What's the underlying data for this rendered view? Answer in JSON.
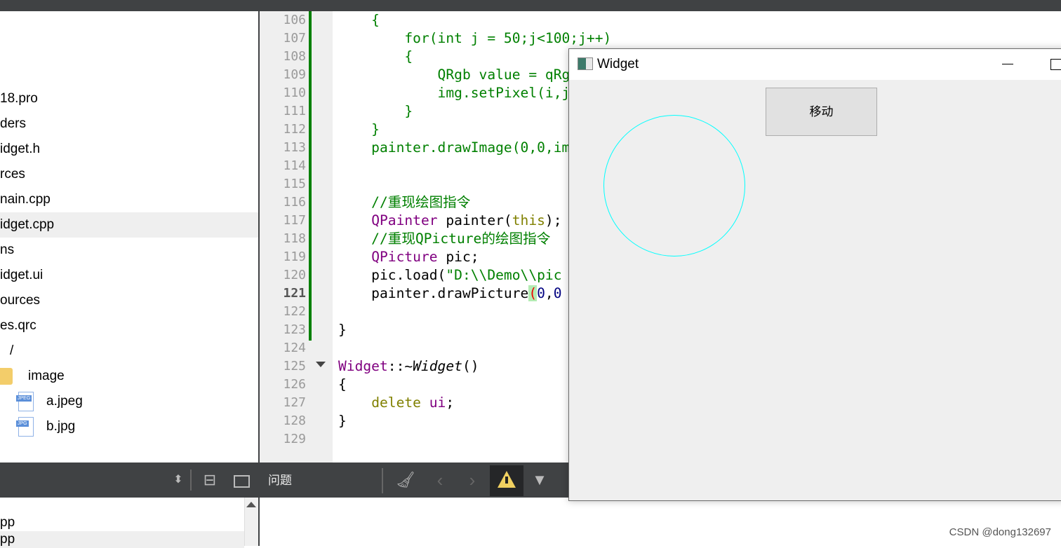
{
  "project_tree": {
    "items": [
      {
        "label": "18.pro",
        "indent": 0
      },
      {
        "label": "ders",
        "indent": 0
      },
      {
        "label": "idget.h",
        "indent": 0
      },
      {
        "label": "rces",
        "indent": 0
      },
      {
        "label": "nain.cpp",
        "indent": 0
      },
      {
        "label": "idget.cpp",
        "indent": 0,
        "selected": true
      },
      {
        "label": "ns",
        "indent": 0
      },
      {
        "label": "idget.ui",
        "indent": 0
      },
      {
        "label": "ources",
        "indent": 0
      },
      {
        "label": "es.qrc",
        "indent": 0
      },
      {
        "label": "/",
        "indent": 14
      },
      {
        "label": "image",
        "indent": 40,
        "icon": "folder-icon"
      },
      {
        "label": "a.jpeg",
        "indent": 66,
        "icon": "jpeg-file-icon",
        "badge": "JPEG"
      },
      {
        "label": "b.jpg",
        "indent": 66,
        "icon": "jpg-file-icon",
        "badge": "JPG"
      }
    ]
  },
  "open_documents": [
    "pp",
    "pp"
  ],
  "editor": {
    "current_line": 121,
    "lines": [
      {
        "n": 106,
        "tokens": [
          [
            "    {",
            "t-cm"
          ]
        ]
      },
      {
        "n": 107,
        "tokens": [
          [
            "        for(int j = 50;j<100;j++)",
            "t-cm"
          ]
        ]
      },
      {
        "n": 108,
        "tokens": [
          [
            "        {",
            "t-cm"
          ]
        ]
      },
      {
        "n": 109,
        "tokens": [
          [
            "            QRgb value = qRgb",
            "t-cm"
          ]
        ]
      },
      {
        "n": 110,
        "tokens": [
          [
            "            img.setPixel(i,j",
            "t-cm"
          ]
        ]
      },
      {
        "n": 111,
        "tokens": [
          [
            "        }",
            "t-cm"
          ]
        ]
      },
      {
        "n": 112,
        "tokens": [
          [
            "    }",
            "t-cm"
          ]
        ]
      },
      {
        "n": 113,
        "tokens": [
          [
            "    painter.drawImage(0,0,im",
            "t-cm"
          ]
        ]
      },
      {
        "n": 114,
        "tokens": []
      },
      {
        "n": 115,
        "tokens": []
      },
      {
        "n": 116,
        "tokens": [
          [
            "    //重现绘图指令",
            "t-cm"
          ]
        ]
      },
      {
        "n": 117,
        "tokens": [
          [
            "    ",
            ""
          ],
          [
            "QPainter",
            "t-ty"
          ],
          [
            " painter(",
            ""
          ],
          [
            "this",
            "t-kw"
          ],
          [
            ");",
            ""
          ]
        ]
      },
      {
        "n": 118,
        "tokens": [
          [
            "    //重现QPicture的绘图指令",
            "t-cm"
          ]
        ]
      },
      {
        "n": 119,
        "tokens": [
          [
            "    ",
            ""
          ],
          [
            "QPicture",
            "t-ty"
          ],
          [
            " pic;",
            ""
          ]
        ]
      },
      {
        "n": 120,
        "tokens": [
          [
            "    pic.load(",
            ""
          ],
          [
            "\"D:\\\\Demo\\\\pic",
            "t-str"
          ]
        ]
      },
      {
        "n": 121,
        "tokens": [
          [
            "    painter.drawPicture",
            ""
          ],
          [
            "(",
            "t-par"
          ],
          [
            "0",
            "t-num"
          ],
          [
            ",",
            ""
          ],
          [
            "0",
            "t-num"
          ]
        ]
      },
      {
        "n": 122,
        "tokens": []
      },
      {
        "n": 123,
        "tokens": [
          [
            "}",
            ""
          ]
        ]
      },
      {
        "n": 124,
        "tokens": []
      },
      {
        "n": 125,
        "tokens": [
          [
            "Widget",
            "t-ty"
          ],
          [
            "::~",
            ""
          ],
          [
            "Widget",
            "t-it"
          ],
          [
            "()",
            ""
          ]
        ],
        "fold": true
      },
      {
        "n": 126,
        "tokens": [
          [
            "{",
            ""
          ]
        ]
      },
      {
        "n": 127,
        "tokens": [
          [
            "    ",
            ""
          ],
          [
            "delete",
            "t-kw"
          ],
          [
            " ",
            ""
          ],
          [
            "ui",
            "t-ty"
          ],
          [
            ";",
            ""
          ]
        ]
      },
      {
        "n": 128,
        "tokens": [
          [
            "}",
            ""
          ]
        ]
      },
      {
        "n": 129,
        "tokens": []
      }
    ]
  },
  "issues_panel": {
    "title": "问题",
    "warning_filter_active": true
  },
  "widget_window": {
    "title": "Widget",
    "button_label": "移动",
    "circle_color": "#00ffff"
  },
  "colors": {
    "change_bar": "#008000",
    "comment": "#008000",
    "type": "#800080",
    "keyword": "#808000",
    "toolbar": "#404244"
  },
  "watermark": "CSDN @dong132697"
}
